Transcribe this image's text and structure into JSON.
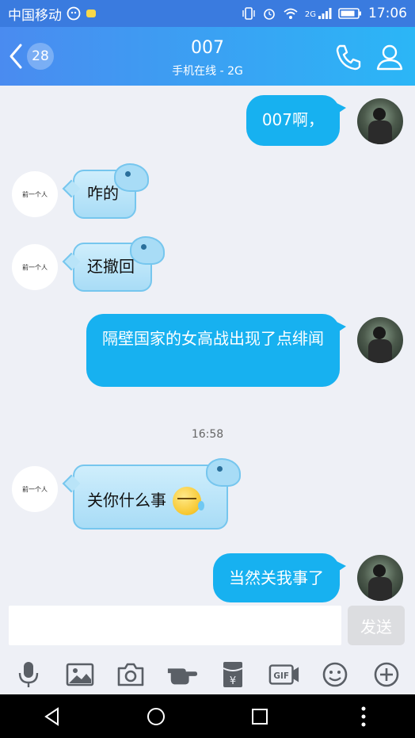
{
  "status": {
    "carrier": "中国移动",
    "network": "2G",
    "time": "17:06"
  },
  "header": {
    "unread_count": "28",
    "title": "007",
    "subtitle": "手机在线 - 2G"
  },
  "contact_avatar_text": "前一个人",
  "messages": [
    {
      "from": "me",
      "text": "007啊，"
    },
    {
      "from": "other",
      "text": "咋的"
    },
    {
      "from": "other",
      "text": "还撤回"
    },
    {
      "from": "me",
      "text": "隔壁国家的女高战出现了点绯闻"
    },
    {
      "type": "time",
      "text": "16:58"
    },
    {
      "from": "other",
      "text": "关你什么事"
    },
    {
      "from": "me",
      "text": "当然关我事了"
    }
  ],
  "input": {
    "send_label": "发送"
  },
  "toolbar": [
    "mic-icon",
    "image-icon",
    "camera-icon",
    "poke-icon",
    "red-packet-icon",
    "gif-icon",
    "emoji-icon",
    "plus-icon"
  ],
  "colors": {
    "header_start": "#4a8bf0",
    "header_end": "#2bb6f6",
    "bubble_me": "#17b1f0",
    "bubble_other": "#a8dcf6"
  }
}
